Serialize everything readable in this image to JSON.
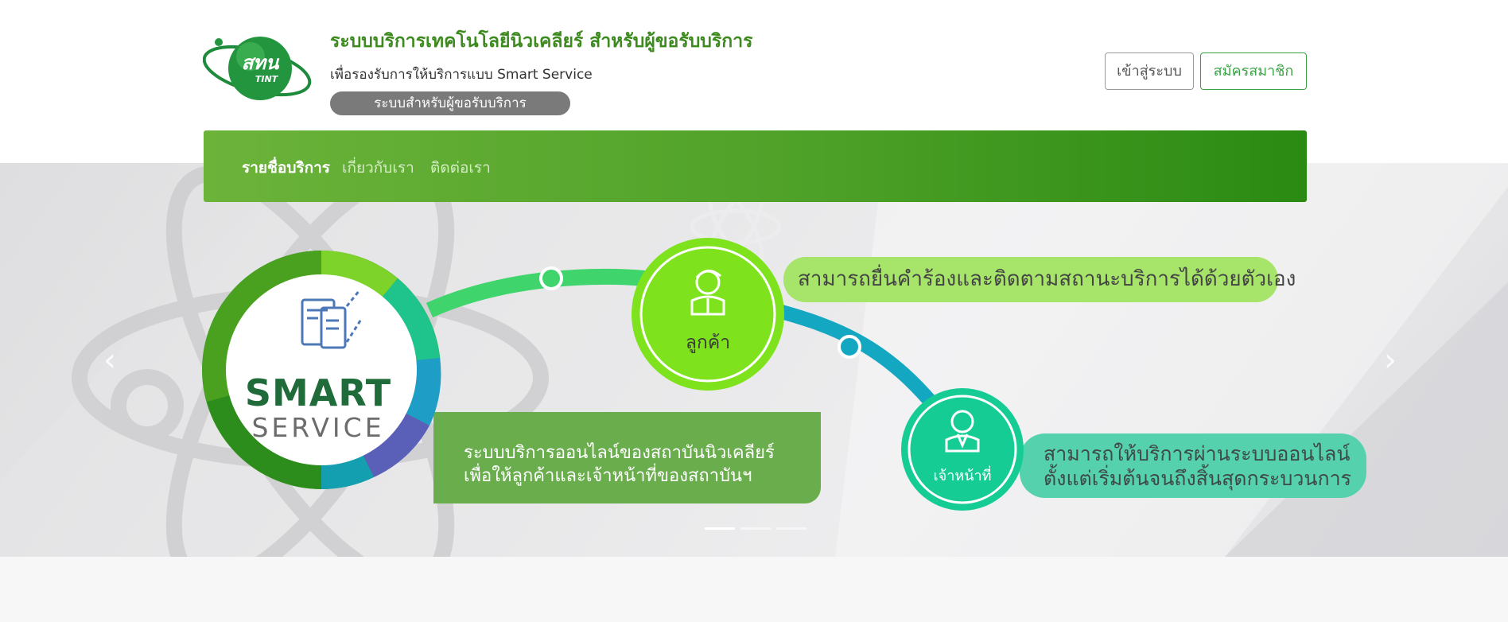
{
  "header": {
    "logo_text_main": "สทน",
    "logo_text_sub": "TINT",
    "title": "ระบบบริการเทคโนโลยีนิวเคลียร์ สำหรับผู้ขอรับบริการ",
    "subtitle": "เพื่อรองรับการให้บริการแบบ Smart Service",
    "pill": "ระบบสำหรับผู้ขอรับบริการ",
    "login_label": "เข้าสู่ระบบ",
    "register_label": "สมัครสมาชิก"
  },
  "nav": {
    "items": [
      {
        "label": "รายชื่อบริการ"
      },
      {
        "label": "เกี่ยวกับเรา"
      },
      {
        "label": "ติดต่อเรา"
      }
    ]
  },
  "banner": {
    "smart_line1": "SMART",
    "smart_line2": "SERVICE",
    "main_text_line1": "ระบบบริการออนไลน์ของสถาบันนิวเคลียร์",
    "main_text_line2": "เพื่อให้ลูกค้าและเจ้าหน้าที่ของสถาบันฯ",
    "customer_label": "ลูกค้า",
    "customer_text": "สามารถยื่นคำร้องและติดตามสถานะบริการได้ด้วยตัวเอง",
    "staff_label": "เจ้าหน้าที่",
    "staff_text_line1": "สามารถให้บริการผ่านระบบออนไลน์",
    "staff_text_line2": "ตั้งแต่เริ่มต้นจนถึงสิ้นสุดกระบวนการ",
    "prev_arrow": "‹",
    "next_arrow": "›",
    "slide_count": 3,
    "active_slide": 1
  },
  "colors": {
    "brand_green": "#3d8a1f",
    "nav_green_start": "#6cb33a",
    "nav_green_end": "#2a8a12",
    "customer_green": "#7ee31c",
    "staff_teal": "#16cc95",
    "bubble_main": "#6aad4d"
  },
  "icons": [
    "smart-service-document-icon",
    "customer-person-icon",
    "staff-person-icon",
    "atom-watermark-icon"
  ]
}
